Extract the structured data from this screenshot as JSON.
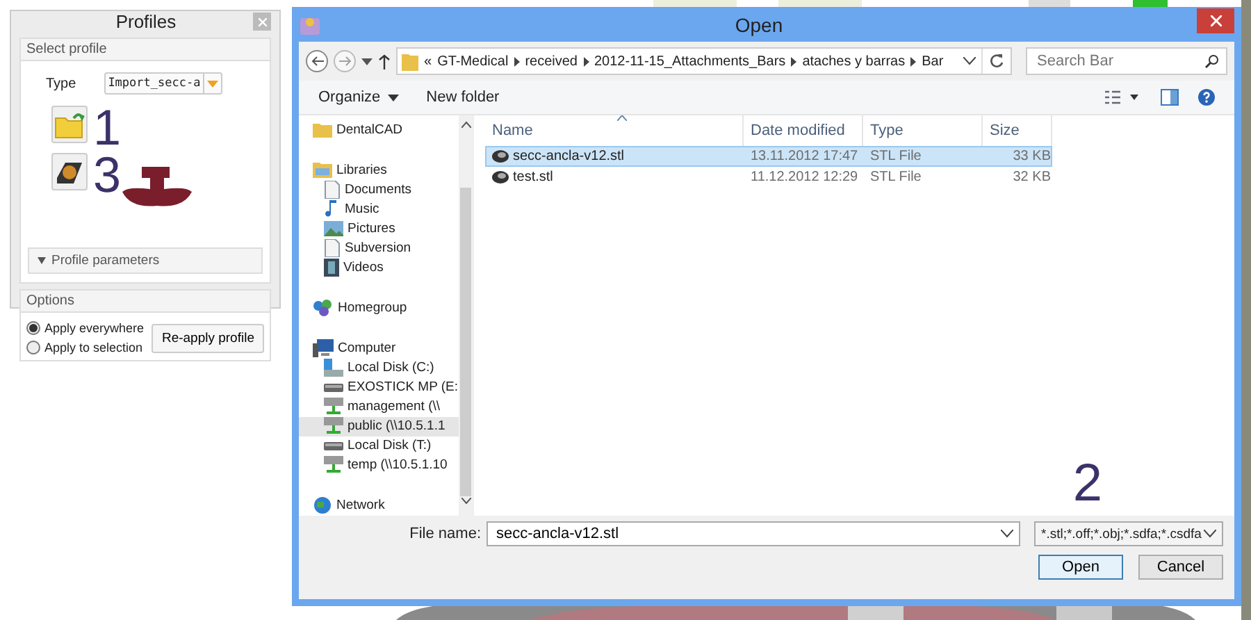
{
  "profiles_panel": {
    "title": "Profiles",
    "select_profile": {
      "title": "Select profile",
      "type_label": "Type",
      "type_value": "Import_secc-a",
      "annotations": [
        "1",
        "3"
      ],
      "parameters_label": "Profile parameters",
      "parameters_expanded": false
    },
    "options": {
      "title": "Options",
      "radios": [
        {
          "label": "Apply everywhere",
          "selected": true
        },
        {
          "label": "Apply to selection",
          "selected": false
        }
      ],
      "button": "Re-apply profile"
    }
  },
  "dialog": {
    "title": "Open",
    "breadcrumbs": [
      "«",
      "GT-Medical",
      "received",
      "2012-11-15_Attachments_Bars",
      "ataches y barras",
      "Bar"
    ],
    "search": {
      "placeholder": "Search Bar"
    },
    "toolbar": [
      "Organize",
      "New folder"
    ],
    "nav": [
      {
        "label": "DentalCAD",
        "kind": "folder",
        "selected": false
      },
      {
        "label": "Libraries",
        "kind": "library",
        "selected": false,
        "children": [
          {
            "label": "Documents",
            "kind": "documents",
            "selected": false
          },
          {
            "label": "Music",
            "kind": "music",
            "selected": false
          },
          {
            "label": "Pictures",
            "kind": "pictures",
            "selected": false
          },
          {
            "label": "Subversion",
            "kind": "documents",
            "selected": false
          },
          {
            "label": "Videos",
            "kind": "videos",
            "selected": false
          }
        ]
      },
      {
        "label": "Homegroup",
        "kind": "homegroup",
        "selected": false
      },
      {
        "label": "Computer",
        "kind": "computer",
        "selected": false,
        "children": [
          {
            "label": "Local Disk (C:)",
            "kind": "disk",
            "selected": false
          },
          {
            "label": "EXOSTICK MP (E:",
            "kind": "usb",
            "selected": false
          },
          {
            "label": "management (\\\\",
            "kind": "netdrive",
            "selected": false
          },
          {
            "label": "public (\\\\10.5.1.1",
            "kind": "netdrive",
            "selected": true
          },
          {
            "label": "Local Disk (T:)",
            "kind": "usb",
            "selected": false
          },
          {
            "label": "temp (\\\\10.5.1.10",
            "kind": "netdrive",
            "selected": false
          }
        ]
      },
      {
        "label": "Network",
        "kind": "network",
        "selected": false
      }
    ],
    "columns": [
      "Name",
      "Date modified",
      "Type",
      "Size"
    ],
    "files": [
      {
        "name": "secc-ancla-v12.stl",
        "date": "13.11.2012 17:47",
        "type": "STL File",
        "size": "33 KB",
        "selected": true
      },
      {
        "name": "test.stl",
        "date": "11.12.2012 12:29",
        "type": "STL File",
        "size": "32 KB",
        "selected": false
      }
    ],
    "file_name_label": "File name:",
    "file_name_value": "secc-ancla-v12.stl",
    "filter": "*.stl;*.off;*.obj;*.sdfa;*.csdfa",
    "annotation": "2",
    "buttons": [
      "Open",
      "Cancel"
    ]
  }
}
